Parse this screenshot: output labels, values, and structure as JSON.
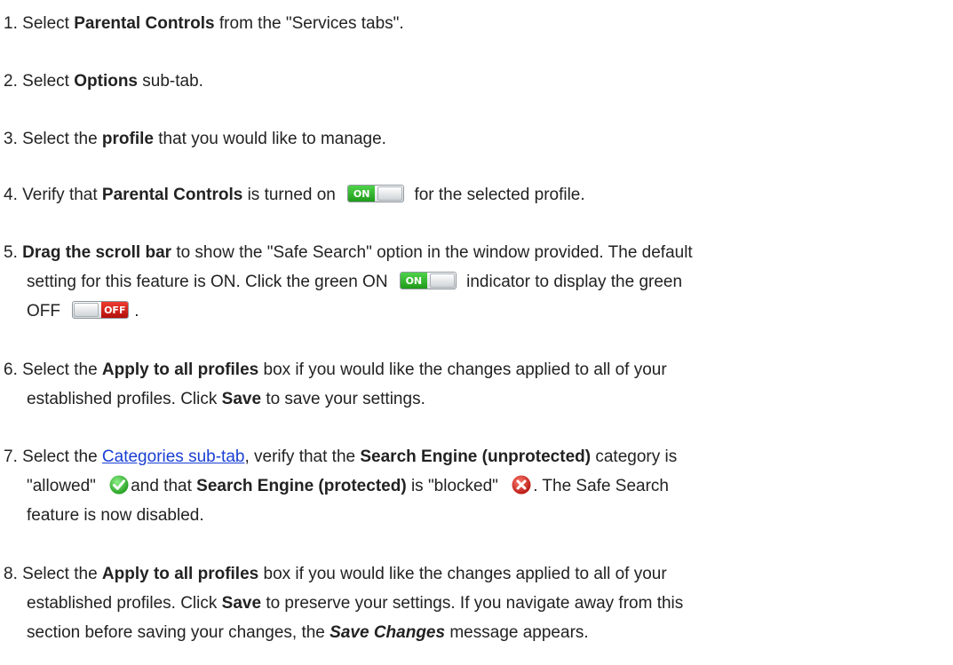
{
  "steps": {
    "s1": {
      "n": "1.",
      "a": "Select",
      "b": "Parental Controls",
      "c": "from the \"Services tabs\"."
    },
    "s2": {
      "n": "2.",
      "a": "Select",
      "b": "Options",
      "c": "sub-tab."
    },
    "s3": {
      "n": "3.",
      "a": "Select the",
      "b": "profile",
      "c": "that you would like to manage."
    },
    "s4": {
      "n": "4.",
      "a": "Verify that",
      "b": "Parental Controls",
      "c": "is turned on",
      "d": "for the selected profile."
    },
    "s5": {
      "n": "5.",
      "b": "Drag the scroll bar",
      "c": "to show the \"Safe Search\" option in the window provided. The default",
      "d": "setting for this feature is ON. Click the green ON",
      "e": "indicator  to display the green",
      "f": "OFF",
      "g": "."
    },
    "s6": {
      "n": "6.",
      "a": "Select the",
      "b": "Apply to all profiles",
      "c": "box if you would like the changes applied to all of your",
      "d": "established profiles. Click",
      "e": "Save",
      "f": "to save your settings."
    },
    "s7": {
      "n": "7.",
      "a": "Select the",
      "link": "Categories sub-tab",
      "c": ", verify that the",
      "d": "Search Engine (unprotected)",
      "e": "category is",
      "f": "\"allowed\"",
      "g": "and that",
      "h": "Search Engine (protected)",
      "i": "is \"blocked\"",
      "j": ". The Safe Search",
      "k": "feature is now disabled."
    },
    "s8": {
      "n": "8.",
      "a": "Select the",
      "b": "Apply to all profiles",
      "c": "box if you would like the changes applied to all of your",
      "d": "established profiles. Click",
      "e": "Save",
      "f": "to preserve your settings. If you navigate away from this",
      "g": "section before saving your changes, the",
      "h": "Save Changes",
      "i": "message appears."
    }
  },
  "toggles": {
    "on_label": "ON",
    "off_label": "OFF"
  },
  "colors": {
    "on_green": "#2db328",
    "off_red": "#d0201a",
    "allowed_green": "#3cbf3a",
    "blocked_red": "#d9261c",
    "link_blue": "#1a3fd4"
  },
  "icons": {
    "allowed": "checkmark-circle-icon",
    "blocked": "x-circle-icon"
  }
}
